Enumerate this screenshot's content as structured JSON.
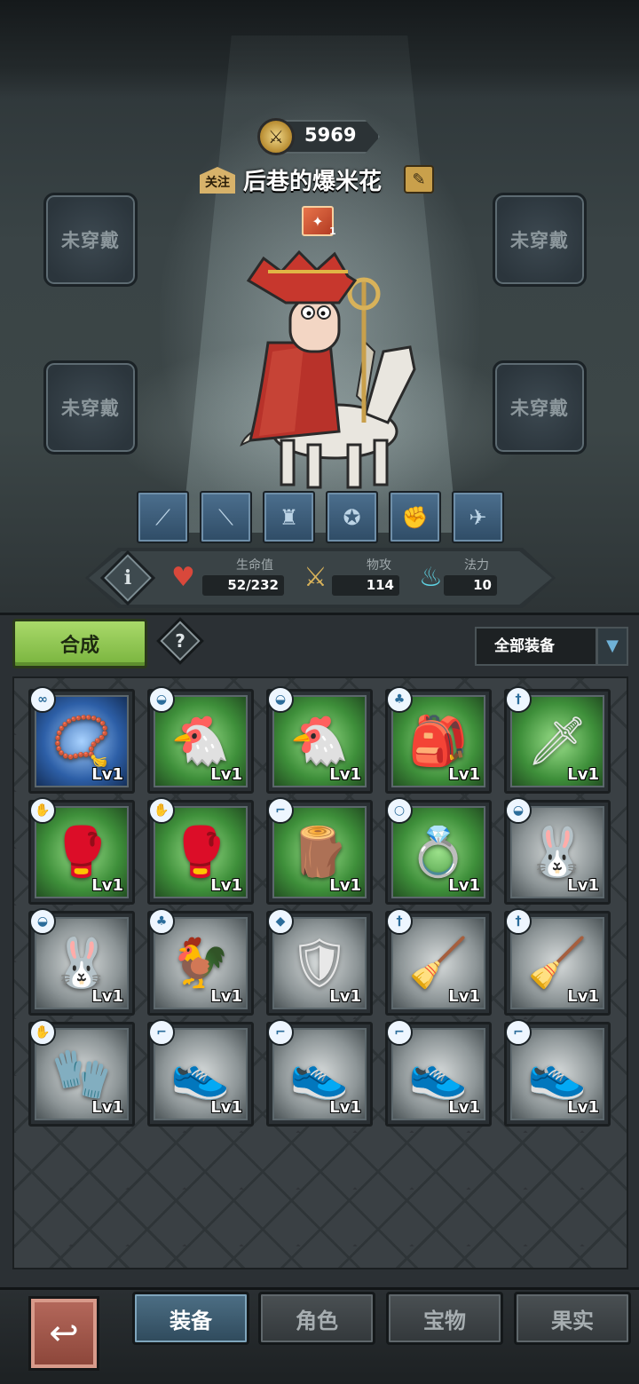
{
  "profile": {
    "power": "5969",
    "follow_label": "关注",
    "name": "后巷的爆米花",
    "title_count": "1"
  },
  "empty_slots": {
    "label": "未穿戴"
  },
  "stats": {
    "hp_label": "生命值",
    "hp_value": "52/232",
    "atk_label": "物攻",
    "atk_value": "114",
    "mp_label": "法力",
    "mp_value": "10"
  },
  "toolbar": {
    "craft_label": "合成",
    "help_label": "?",
    "filter_selected": "全部装备"
  },
  "items": [
    {
      "name": "necklace",
      "level": "Lv1",
      "rarity": "blue"
    },
    {
      "name": "chicken-hood",
      "level": "Lv1",
      "rarity": "green"
    },
    {
      "name": "chicken-hood",
      "level": "Lv1",
      "rarity": "green"
    },
    {
      "name": "leather-armor",
      "level": "Lv1",
      "rarity": "green"
    },
    {
      "name": "sword",
      "level": "Lv1",
      "rarity": "green"
    },
    {
      "name": "red-gloves",
      "level": "Lv1",
      "rarity": "green"
    },
    {
      "name": "red-gloves",
      "level": "Lv1",
      "rarity": "green"
    },
    {
      "name": "wooden-shoes",
      "level": "Lv1",
      "rarity": "green"
    },
    {
      "name": "jade-ring",
      "level": "Lv1",
      "rarity": "green"
    },
    {
      "name": "bunny-hood",
      "level": "Lv1",
      "rarity": "gray"
    },
    {
      "name": "bunny-hood",
      "level": "Lv1",
      "rarity": "gray"
    },
    {
      "name": "chicken-costume",
      "level": "Lv1",
      "rarity": "gray"
    },
    {
      "name": "wooden-shield",
      "level": "Lv1",
      "rarity": "gray"
    },
    {
      "name": "mop",
      "level": "Lv1",
      "rarity": "gray"
    },
    {
      "name": "mop",
      "level": "Lv1",
      "rarity": "gray"
    },
    {
      "name": "leather-glove",
      "level": "Lv1",
      "rarity": "gray"
    },
    {
      "name": "white-shoes",
      "level": "Lv1",
      "rarity": "gray"
    },
    {
      "name": "white-shoes",
      "level": "Lv1",
      "rarity": "gray"
    },
    {
      "name": "white-shoes",
      "level": "Lv1",
      "rarity": "gray"
    },
    {
      "name": "white-shoes",
      "level": "Lv1",
      "rarity": "gray"
    }
  ],
  "nav": {
    "tabs": [
      {
        "label": "装备",
        "active": true
      },
      {
        "label": "角色",
        "active": false
      },
      {
        "label": "宝物",
        "active": false
      },
      {
        "label": "果实",
        "active": false
      }
    ]
  }
}
